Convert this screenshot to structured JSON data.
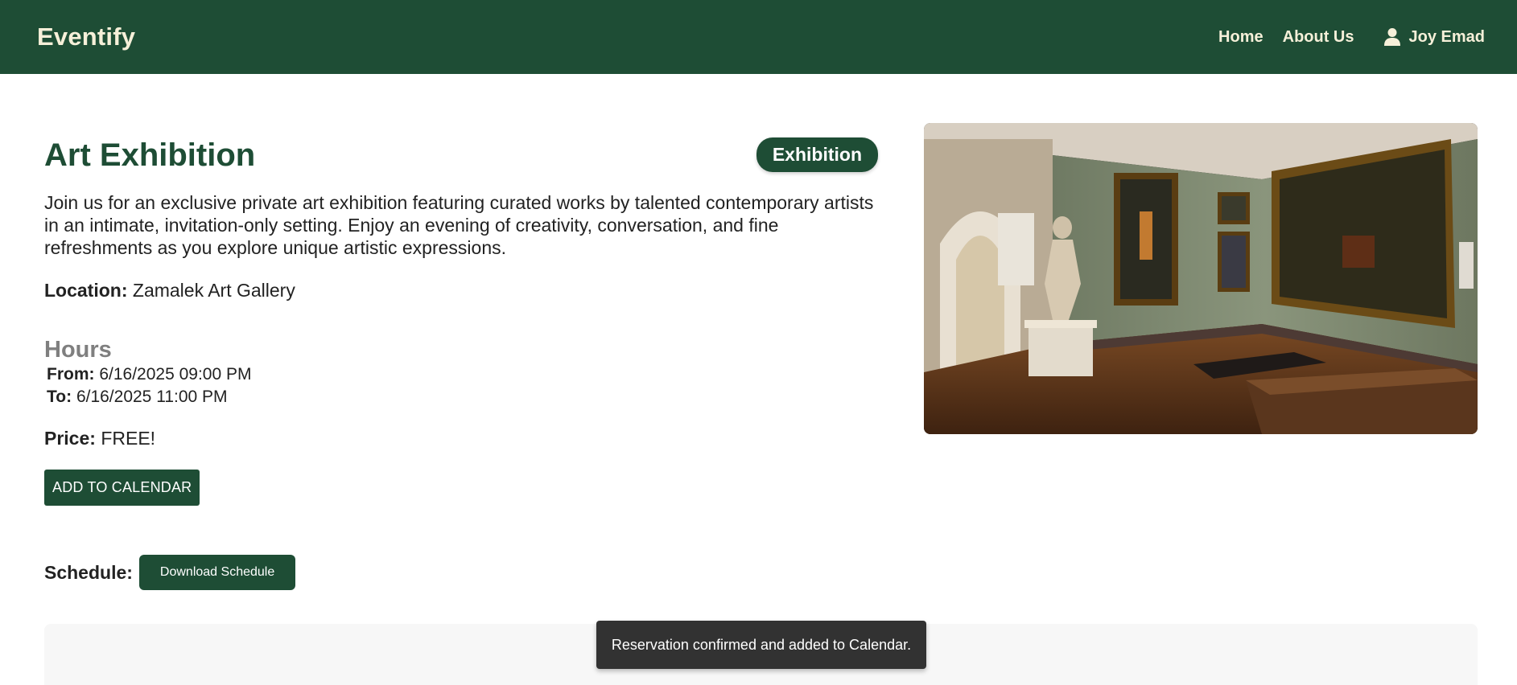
{
  "nav": {
    "brand": "Eventify",
    "links": [
      "Home",
      "About Us"
    ],
    "user_name": "Joy Emad",
    "user_icon": "person-icon"
  },
  "event": {
    "title": "Art Exhibition",
    "category": "Exhibition",
    "description": "Join us for an exclusive private art exhibition featuring curated works by talented contemporary artists in an intimate, invitation-only setting. Enjoy an evening of creativity, conversation, and fine refreshments as you explore unique artistic expressions.",
    "location_label": "Location:",
    "location": "Zamalek Art Gallery",
    "hours_heading": "Hours",
    "from_label": "From:",
    "from": "6/16/2025 09:00 PM",
    "to_label": "To:",
    "to": "6/16/2025 11:00 PM",
    "price_label": "Price:",
    "price": "FREE!",
    "add_to_calendar": "ADD TO CALENDAR",
    "schedule_label": "Schedule:",
    "download_schedule": "Download Schedule"
  },
  "toast": {
    "message": "Reservation confirmed and added to Calendar."
  },
  "colors": {
    "primary": "#1e4d35",
    "nav_text": "#f6f0d9",
    "toast_bg": "#323232"
  }
}
